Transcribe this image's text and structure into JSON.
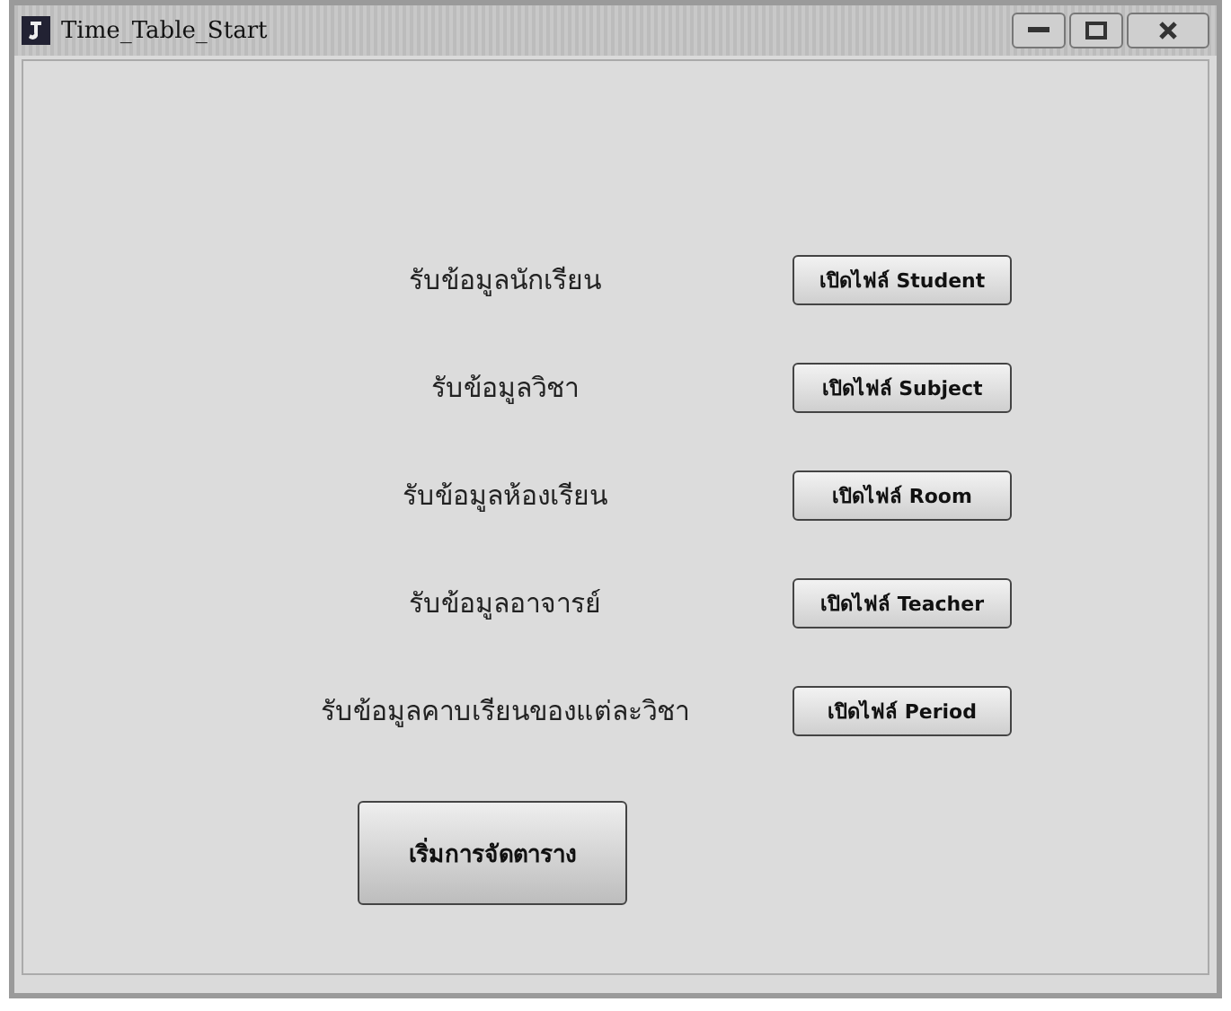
{
  "window": {
    "title": "Time_Table_Start"
  },
  "rows": [
    {
      "label": "รับข้อมูลนักเรียน",
      "button": "เปิดไฟล์ Student"
    },
    {
      "label": "รับข้อมูลวิชา",
      "button": "เปิดไฟล์ Subject"
    },
    {
      "label": "รับข้อมูลห้องเรียน",
      "button": "เปิดไฟล์ Room"
    },
    {
      "label": "รับข้อมูลอาจารย์",
      "button": "เปิดไฟล์ Teacher"
    },
    {
      "label": "รับข้อมูลคาบเรียนของแต่ละวิชา",
      "button": "เปิดไฟล์ Period"
    }
  ],
  "start_button": "เริ่มการจัดตาราง"
}
